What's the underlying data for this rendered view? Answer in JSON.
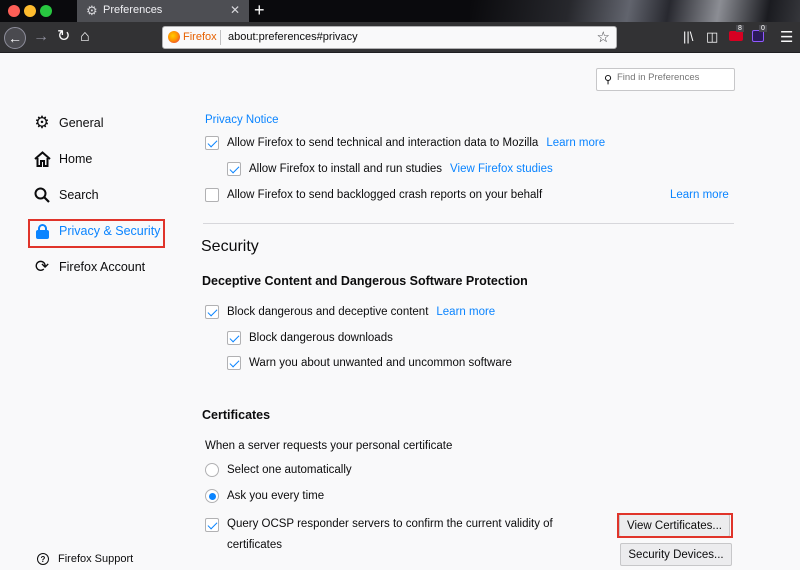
{
  "window": {
    "tab_title": "Preferences",
    "tab_icon": "gear-icon",
    "new_tab": "+"
  },
  "toolbar": {
    "identity_label": "Firefox",
    "url": "about:preferences#privacy",
    "ext1_badge": "8",
    "ext2_badge": "0"
  },
  "search": {
    "placeholder": "Find in Preferences"
  },
  "sidebar": {
    "items": [
      {
        "label": "General",
        "icon": "gear-icon"
      },
      {
        "label": "Home",
        "icon": "home-icon"
      },
      {
        "label": "Search",
        "icon": "search-icon"
      },
      {
        "label": "Privacy & Security",
        "icon": "lock-icon",
        "selected": true
      },
      {
        "label": "Firefox Account",
        "icon": "sync-icon"
      }
    ],
    "support_label": "Firefox Support"
  },
  "data_collection": {
    "privacy_notice": "Privacy Notice",
    "telemetry_label": "Allow Firefox to send technical and interaction data to Mozilla",
    "telemetry_learn_more": "Learn more",
    "telemetry_checked": true,
    "studies_label": "Allow Firefox to install and run studies",
    "studies_link": "View Firefox studies",
    "studies_checked": true,
    "crash_label": "Allow Firefox to send backlogged crash reports on your behalf",
    "crash_learn_more": "Learn more",
    "crash_checked": false
  },
  "security": {
    "heading": "Security",
    "deceptive_heading": "Deceptive Content and Dangerous Software Protection",
    "block_label": "Block dangerous and deceptive content",
    "block_learn_more": "Learn more",
    "block_checked": true,
    "downloads_label": "Block dangerous downloads",
    "downloads_checked": true,
    "unwanted_label": "Warn you about unwanted and uncommon software",
    "unwanted_checked": true
  },
  "certificates": {
    "heading": "Certificates",
    "description": "When a server requests your personal certificate",
    "auto_label": "Select one automatically",
    "ask_label": "Ask you every time",
    "selected_option": "ask",
    "ocsp_label": "Query OCSP responder servers to confirm the current validity of certificates",
    "ocsp_checked": true,
    "view_button": "View Certificates...",
    "devices_button": "Security Devices..."
  },
  "colors": {
    "accent": "#0a84ff",
    "highlight": "#e0342a"
  }
}
